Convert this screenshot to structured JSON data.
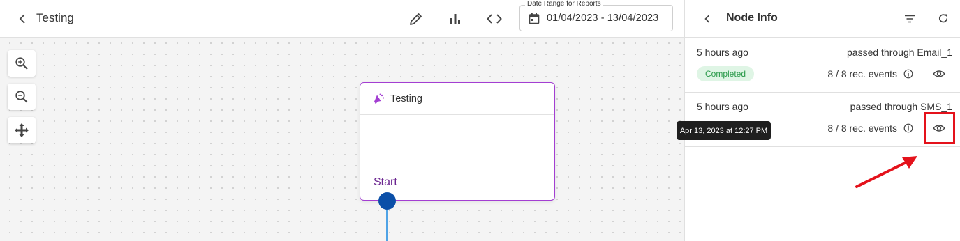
{
  "header": {
    "title": "Testing",
    "date_range": {
      "label": "Date Range for Reports",
      "value": "01/04/2023 - 13/04/2023"
    }
  },
  "canvas": {
    "node": {
      "title": "Testing",
      "start_label": "Start",
      "accent_color": "#a33ed2"
    }
  },
  "panel": {
    "title": "Node Info",
    "events": [
      {
        "time": "5 hours ago",
        "node": "passed through Email_1",
        "status": "Completed",
        "rec_events": "8 / 8 rec. events"
      },
      {
        "time": "5 hours ago",
        "node": "passed through SMS_1",
        "status": "",
        "rec_events": "8 / 8 rec. events"
      }
    ],
    "tooltip": "Apr 13, 2023 at 12:27 PM"
  },
  "icons": [
    "chevron-left-icon",
    "pencil-icon",
    "bar-chart-icon",
    "code-icon",
    "calendar-icon",
    "zoom-in-icon",
    "zoom-out-icon",
    "move-icon",
    "megaphone-icon",
    "filter-icon",
    "refresh-icon",
    "info-icon",
    "eye-icon"
  ],
  "colors": {
    "status_bg": "#dff5e5",
    "status_text": "#2a9a4a",
    "handle": "#0b4fa8",
    "annotation": "#e4121b"
  }
}
